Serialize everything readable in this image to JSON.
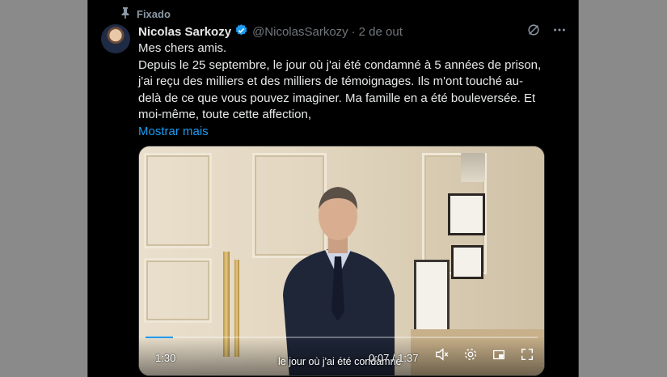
{
  "tweet": {
    "pinned_label": "Fixado",
    "author_name": "Nicolas Sarkozy",
    "handle": "@NicolasSarkozy",
    "separator": "·",
    "date": "2 de out",
    "text_lines": [
      "Mes chers amis.",
      "Depuis le 25 septembre, le jour où j'ai été condamné à 5 années de prison,",
      "j'ai reçu des milliers et des milliers de témoignages. Ils m'ont touché au-",
      "delà de ce que vous pouvez imaginer. Ma famille en a été bouleversée. Et",
      "moi-même, toute cette affection,"
    ],
    "show_more": "Mostrar mais"
  },
  "video": {
    "time_left": "1:30",
    "time_right": "0:07 / 1:37",
    "subtitle": "le jour où j'ai été condamné",
    "progress": 0.07
  },
  "icons": {
    "pin": "pin-icon",
    "verified": "verified-badge-icon",
    "grok": "grok-icon",
    "more": "more-icon",
    "mute": "mute-icon",
    "settings": "gear-icon",
    "pip": "picture-in-picture-icon",
    "fullscreen": "fullscreen-icon"
  },
  "colors": {
    "background": "#000000",
    "text": "#e7e9ea",
    "secondary": "#71767b",
    "link": "#1d9bf0",
    "verified": "#1d9bf0"
  }
}
